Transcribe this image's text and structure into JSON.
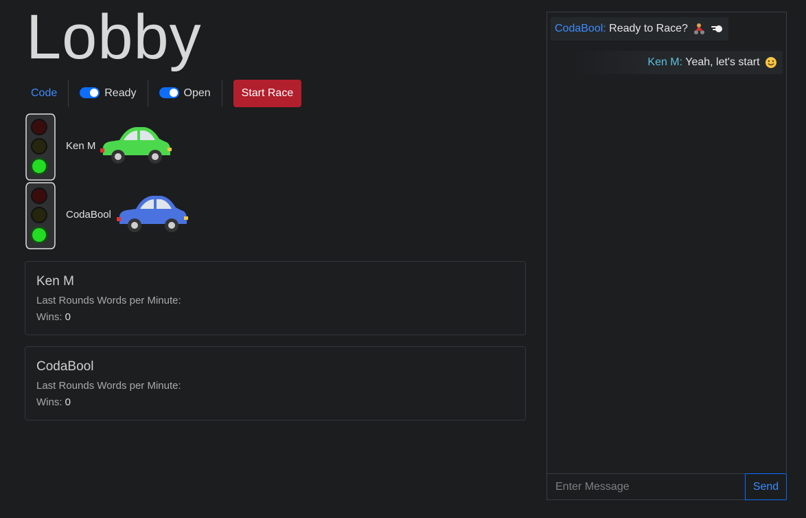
{
  "page": {
    "title": "Lobby"
  },
  "toolbar": {
    "code_label": "Code",
    "ready_label": "Ready",
    "ready_on": true,
    "open_label": "Open",
    "open_on": true,
    "start_label": "Start Race"
  },
  "racers": [
    {
      "name": "Ken M",
      "car_color": "#4cd84c",
      "light": "green"
    },
    {
      "name": "CodaBool",
      "car_color": "#4a73e0",
      "light": "green"
    }
  ],
  "stats": [
    {
      "name": "Ken M",
      "wpm_label": "Last Rounds Words per Minute:",
      "wpm_value": "",
      "wins_label": "Wins:",
      "wins_value": "0"
    },
    {
      "name": "CodaBool",
      "wpm_label": "Last Rounds Words per Minute:",
      "wpm_value": "",
      "wins_label": "Wins:",
      "wins_value": "0"
    }
  ],
  "chat": {
    "messages": [
      {
        "sender": "CodaBool:",
        "text": "Ready to Race?",
        "emoji": [
          "racer-icon",
          "dash-icon"
        ]
      },
      {
        "sender": "Ken M:",
        "text": "Yeah, let's start",
        "emoji": [
          "smile-icon"
        ]
      }
    ],
    "input_placeholder": "Enter Message",
    "send_label": "Send"
  },
  "colors": {
    "background": "#1b1d1f",
    "accent": "#0d6efd",
    "danger": "#b21f2d",
    "green_light": "#22dd22"
  }
}
